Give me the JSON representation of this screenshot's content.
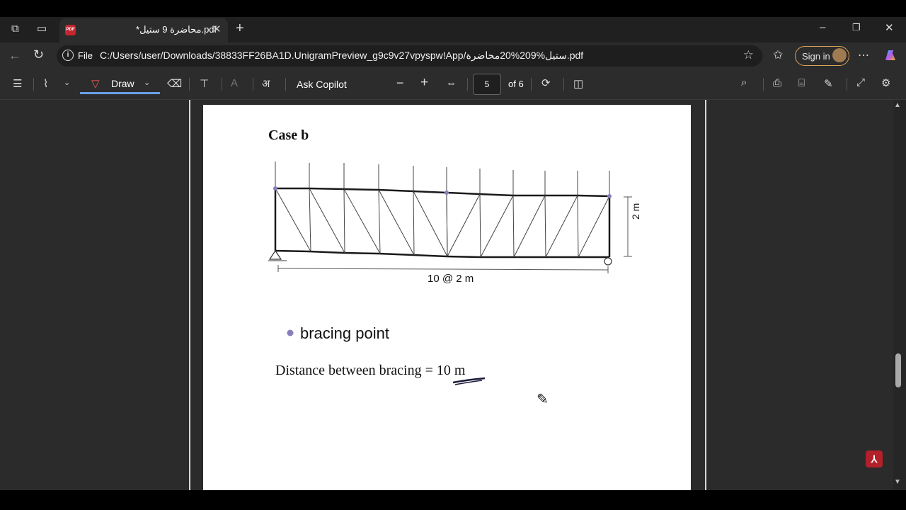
{
  "tab": {
    "title": "*محاضرة 9 ستيل.pdf",
    "pdf_badge": "PDF"
  },
  "address": {
    "file_label": "File",
    "url": "C:/Users/user/Downloads/38833FF26BA1D.UnigramPreview_g9c9v27vpyspw!App/ستيل%209%20محاضرة.pdf"
  },
  "signin": {
    "label": "Sign in"
  },
  "toolbar": {
    "draw_label": "Draw",
    "ask_copilot": "Ask Copilot",
    "current_page": "5",
    "page_total": "of 6",
    "read_aloud_glyph": "अ"
  },
  "document": {
    "heading": "Case b",
    "dimension_height": "2 m",
    "dimension_span": "10 @ 2 m",
    "legend_label": "bracing point",
    "distance_text": "Distance between bracing = ",
    "distance_value": "10 m"
  },
  "colors": {
    "accent": "#6aa0e8",
    "bracing_point": "#8a7fb8",
    "pdf_red": "#c4262e"
  }
}
